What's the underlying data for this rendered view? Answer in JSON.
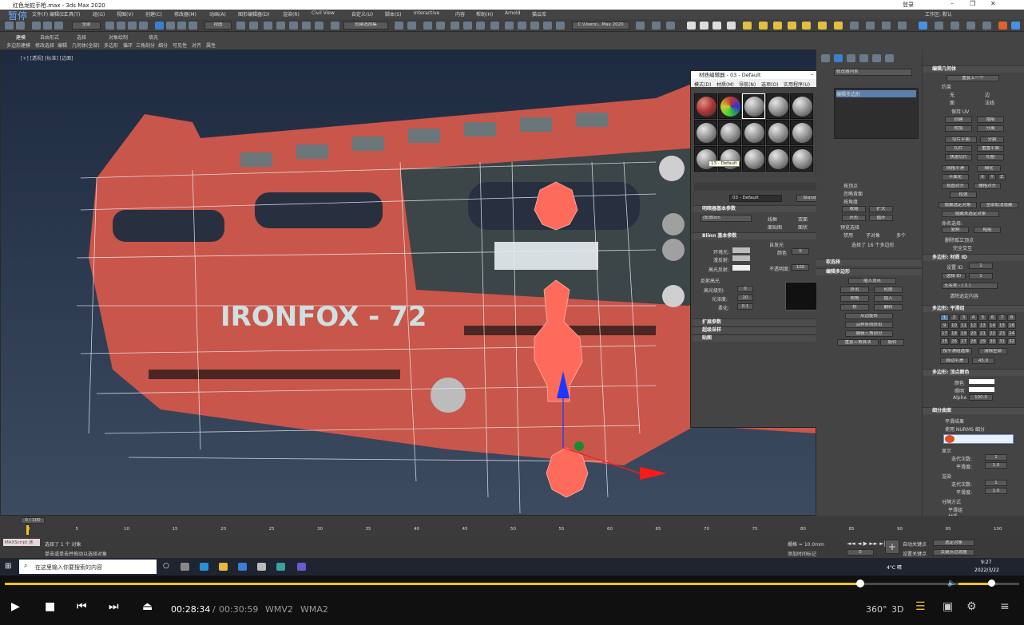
{
  "window": {
    "title": "红色龙蛇手枪.max - 3ds Max 2020",
    "pause_label": "暂停",
    "workspace": "工作区: 默认",
    "user": "登录"
  },
  "menu": [
    "文件(F)",
    "编辑(E)",
    "工具(T)",
    "组(G)",
    "视图(V)",
    "创建(C)",
    "修改器(M)",
    "动画(A)",
    "图形编辑器(D)",
    "渲染(R)",
    "Civil View",
    "自定义(U)",
    "脚本(S)",
    "Interactive",
    "内容",
    "帮助(H)",
    "Arnold",
    "猫云库"
  ],
  "toolbar": {
    "selection_filter": "全部",
    "view_dropdown": "视图",
    "named_selection": "创建选择集",
    "path": "C:\\Users\\...Max 2020"
  },
  "ribbon": {
    "tabs": [
      "建模",
      "自由形式",
      "选择",
      "对象绘制",
      "填充"
    ],
    "subtabs": [
      "多边形建模",
      "修改选择",
      "编辑",
      "几何体(全部)",
      "多边形",
      "循环",
      "三角剖分",
      "细分",
      "可见性",
      "对齐",
      "属性"
    ]
  },
  "viewport": {
    "label": "[+] [透视] [标准] [边面]",
    "decal_text": "IRONFOX - 72"
  },
  "material_editor": {
    "title": "材质编辑器 - 03 - Default",
    "menu": [
      "模式(D)",
      "材质(M)",
      "导航(N)",
      "选项(O)",
      "实用程序(U)"
    ],
    "tooltip": "13 - Default",
    "material_name": "03 - Default",
    "material_type": "Standard",
    "section_shader": "明暗器基本参数",
    "shader": "(B)Blinn",
    "shader_options": [
      "线框",
      "双面",
      "面贴图",
      "面状"
    ],
    "section_blinn": "Blinn 基本参数",
    "self_illum": "自发光",
    "color_label": "颜色",
    "color_value": "0",
    "ambient": "环境光:",
    "diffuse": "漫反射:",
    "specular": "高光反射:",
    "opacity_label": "不透明度:",
    "opacity_value": "100",
    "reflect_highlight": "反射高光",
    "spec_level": "高光级别:",
    "spec_level_value": "0",
    "glossiness": "光泽度:",
    "glossiness_value": "10",
    "soften": "柔化:",
    "soften_value": "0.1",
    "rollouts": [
      "扩展参数",
      "超级采样",
      "贴图"
    ]
  },
  "command_panel": {
    "modifier_list": "修改器列表",
    "stack_item": "编辑多边形",
    "sub_label": "顶点",
    "checkboxes": [
      "按顶点",
      "忽略背面",
      "按角度",
      "收缩",
      "扩大",
      "环形",
      "循环"
    ],
    "preview_label": "预览选择",
    "preview_options": [
      "禁用",
      "子对象",
      "多个"
    ],
    "selected_info": "选择了 16 个多边形",
    "soft_select": "软选择",
    "edit_poly_head": "编辑多边形",
    "edit_buttons": [
      "插入顶点",
      "挤出",
      "轮廓",
      "倒角",
      "插入",
      "桥",
      "翻转",
      "从边旋转",
      "沿样条线挤出",
      "编辑三角剖分",
      "重复三角算法",
      "旋转"
    ]
  },
  "right_panel": {
    "edit_geometry": "编辑几何体",
    "repeat_last": "重复上一个",
    "constraints": "约束",
    "constraint_options": [
      "无",
      "边",
      "面",
      "法线"
    ],
    "preserve_uv": "保持 UV",
    "create": "创建",
    "collapse": "塌陷",
    "attach": "附加",
    "detach": "分离",
    "slice_plane": "切片平面",
    "split": "分割",
    "slice": "切片",
    "reset_plane": "重置平面",
    "quickslice": "快速切片",
    "cut": "切割",
    "meshsmooth": "网格平滑",
    "tessellate": "细化",
    "planarize": "平面化",
    "xyz": [
      "X",
      "Y",
      "Z"
    ],
    "view_align": "视图对齐",
    "grid_align": "栅格对齐",
    "relax": "松弛",
    "hide_selected": "隐藏选定对象",
    "unhide_all": "全部取消隐藏",
    "hide_unselected": "隐藏未选定对象",
    "named_sel": "命名选择:",
    "copy": "复制",
    "paste": "粘贴",
    "delete_isolated": "删除孤立顶点",
    "full_interact": "完全交互",
    "poly_mat_id": "多边形: 材质 ID",
    "set_id": "设置 ID",
    "set_id_value": "1",
    "select_id": "选择 ID",
    "select_id_value": "1",
    "no_name": "无名称 - ( 1 )",
    "clear_selection": "清除选定内容",
    "smoothing_groups": "多边形: 平滑组",
    "sg_numbers": [
      "1",
      "2",
      "3",
      "4",
      "5",
      "6",
      "7",
      "8",
      "9",
      "10",
      "11",
      "12",
      "13",
      "14",
      "15",
      "16",
      "17",
      "18",
      "19",
      "20",
      "21",
      "22",
      "23",
      "24",
      "25",
      "26",
      "27",
      "28",
      "29",
      "30",
      "31",
      "32"
    ],
    "select_by_sg": "按平滑组选择",
    "clear_all": "清除全部",
    "auto_smooth": "自动平滑",
    "auto_smooth_value": "45.0",
    "vertex_colors": "多边形: 顶点颜色",
    "color": "颜色",
    "illumination": "照明",
    "alpha": "Alpha",
    "alpha_value": "100.0",
    "subdivision": "细分曲面",
    "smooth_result": "平滑结果",
    "use_nurms": "使用 NURMS 细分",
    "display": "显示",
    "iterations": "迭代次数:",
    "iterations_value": "1",
    "smoothness": "平滑度:",
    "smoothness_value": "1.0",
    "render": "渲染",
    "separate_by": "分隔方式",
    "smoothing_group": "平滑组",
    "materials": "材质"
  },
  "timeline": {
    "frame_range": "0 / 100",
    "ticks": [
      "0",
      "5",
      "10",
      "15",
      "20",
      "25",
      "30",
      "35",
      "40",
      "45",
      "50",
      "55",
      "60",
      "65",
      "70",
      "75",
      "80",
      "85",
      "90",
      "95",
      "100"
    ]
  },
  "status": {
    "maxscript": "MAXScript 迷",
    "selected": "选择了 1 个 对象",
    "hint": "单击或单击并拖动以选择对象",
    "grid": "栅格 = 10.0mm",
    "add_time_tag": "添加时间标记",
    "auto_key": "自动关键点",
    "set_key": "设置关键点",
    "selected_obj": "选定对象",
    "key_filters": "关键点过滤器",
    "frame": "0"
  },
  "taskbar": {
    "search_placeholder": "在这里输入你要搜索的内容",
    "weather": "4°C 晴",
    "time": "9:27",
    "date": "2022/3/22"
  },
  "player": {
    "current_time": "00:28:34",
    "separator": "/",
    "total_time": "00:30:59",
    "codec_video": "WMV2",
    "codec_audio": "WMA2",
    "label_360": "360°",
    "label_3d": "3D",
    "progress": 0.843,
    "volume": 0.8
  },
  "colors": {
    "accent_yellow": "#f0c419",
    "selection_red": "#ff6b5b",
    "gun_red": "#c9564a",
    "ui_dark": "#444444"
  }
}
